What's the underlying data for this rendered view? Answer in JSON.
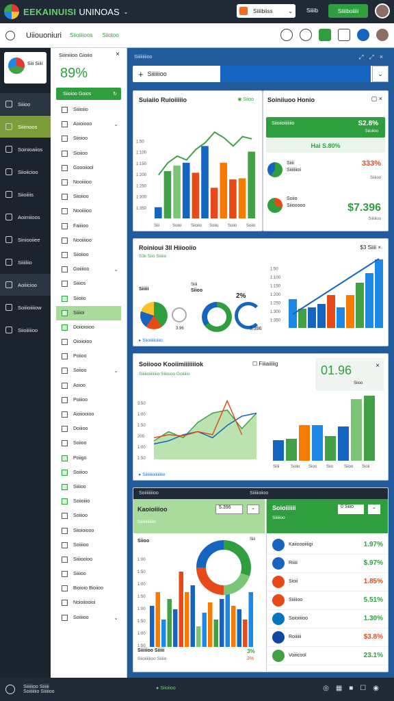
{
  "topbar": {
    "brand": "EEKAINUISI",
    "brand2": "UNINOAS",
    "dropdown": "Siiiibiiss",
    "user": "Siiiib",
    "action": "Siiiiboiiiii"
  },
  "toolbar": {
    "title": "Uiiouoniuri",
    "sub1": "Siioiiiioos",
    "sub2": "Siiotoo"
  },
  "nav": {
    "card_title": "Siii\nSiiii",
    "items": [
      "Siiioo",
      "Siiimoos",
      "Soinioaiios",
      "Siioiicioo",
      "Siioiiiis",
      "Aoimiioos",
      "Siniooiiee",
      "Siiiiliio",
      "Aoiiicioo",
      "Soiiioiiiiow",
      "Siioiiiiioo"
    ]
  },
  "filters": {
    "head": "Siiiniiioo Gioiio",
    "kpi": "89%",
    "green": "Siioioo Goios",
    "rows": [
      "Siiiioiio",
      "Aoioiooo",
      "Siioioo",
      "Sioiioo",
      "Goooiiool",
      "Nooiiiioo",
      "Siioiioo",
      "Nooiiiioo",
      "Faiiiioo",
      "Nooiiiioo",
      "Siioiioo",
      "Goiiiioo",
      "Siiiios",
      "Siioiio",
      "Siiiioi",
      "Doiioioioo",
      "Oioiioioo",
      "Poiioo",
      "Soiioo",
      "Aoioo",
      "Poiiioo",
      "Aioiiooioo",
      "Doiiioo",
      "Soiioo",
      "Poiigo",
      "Soiiioo",
      "Siiiioo",
      "Soiioiiio",
      "Soiiioo",
      "Siioioiooo",
      "Soiiiioo",
      "Siiiiooioo",
      "Siiiioo",
      "Bioioio Bioiioo",
      "Noioiiooioi",
      "Soiiiioo"
    ]
  },
  "main": {
    "header": "Siiiiiiiiioo",
    "search": "Siiiiiioo"
  },
  "p1": {
    "title": "Suiaiio Ruioiiiiio",
    "badge": "Siioo",
    "ticks": [
      "1:350",
      "1:300",
      "1:250",
      "1:200",
      "1:150",
      "1:100",
      "1:50"
    ],
    "xticks": [
      "Siii",
      "Soiio",
      "Siioiio",
      "Soiio",
      "Soiio",
      "Soiio"
    ]
  },
  "p2": {
    "title": "Soiniiuoo Honio",
    "green": "Siioiioiiiiiiio",
    "gval": "S2.8%",
    "gsub": "Siioiioo",
    "pct": "Hai S.80%",
    "r1a": "Siiii",
    "r1b": "Siiiiiiioi",
    "r1v": "333%",
    "r1s": "Siiiioo",
    "r2a": "Soiio",
    "r2b": "Siiooooo",
    "r2v": "$7.396",
    "r2s": "Siiiiiioo"
  },
  "p3": {
    "title": "Roinioui 3ll Hiiooiio",
    "subtitle": "S3ii Siio Siiiiio",
    "badge": "$3 Siiii",
    "l1": "Siiiii",
    "l2": "Siiii",
    "l3": "Siioo",
    "v1": "2%",
    "v2": "3.396",
    "foot": "Siioiiiiioiiio",
    "ticks": [
      "1:350",
      "1:300",
      "1:250",
      "1:200",
      "1:150",
      "1:100",
      "1:50"
    ]
  },
  "p4": {
    "title": "Soiiooo Kooiimiiiiiiiok",
    "sub": "Siiiiioiiiiiiiio Siiioioo Goiiiiio",
    "chk": "Fiiiaiiiiig",
    "kpi": "01.96",
    "kpisub": "Siioo",
    "foot": "Siiiiiiioiiiiiiiio",
    "xt": [
      "Siiii",
      "Soiio",
      "Sioo",
      "Siio",
      "Siioo",
      "Sioii"
    ]
  },
  "p5": {
    "hdr_l": "Soiiiiiiiioo",
    "hdr_r": "Siiiiioiioo",
    "title": "Kaoioiiioo",
    "dd": "5.396",
    "sub": "Siiiiiiiiiiiiio",
    "leg": "Siioo",
    "leg2": "Siii",
    "foot1": "Siiiiioo Siiiii",
    "foot2": "Siioiiiiiioo Siiiio",
    "fv1": "3%",
    "fv2": "3%",
    "rtitle": "Soioiiiiii",
    "rsub": "Siiiiioo",
    "rdd": "0 Siiio",
    "list": [
      {
        "n": "Kaiioooiiiigi",
        "v": "1.97%",
        "c": "#1565c0"
      },
      {
        "n": "Riiiii",
        "v": "$.97%",
        "c": "#1565c0"
      },
      {
        "n": "Sioii",
        "v": "1.85%",
        "c": "#e64a19"
      },
      {
        "n": "Siiiiioo",
        "v": "5.51%",
        "c": "#e64a19"
      },
      {
        "n": "Soioiiiioo",
        "v": "1.30%",
        "c": "#0277bd"
      },
      {
        "n": "Roiiiiii",
        "v": "$3.8%",
        "c": "#0d47a1"
      },
      {
        "n": "Voiiicool",
        "v": "23.1%",
        "c": "#43a047"
      }
    ],
    "listsub": [
      "Siiio",
      "Siiio"
    ]
  },
  "bottom": {
    "l1": "Siiiiiioo Siiiiii",
    "l2": "Soiiiiiiio Siiiiioo",
    "status": "Siioiioo"
  },
  "colors": {
    "green": "#2e9e3f",
    "blue": "#1565c0",
    "orange": "#f57c00",
    "red": "#e64a19"
  },
  "chart_data": [
    {
      "type": "bar",
      "title": "Suiaiio Ruioiiiiio",
      "series": [
        {
          "name": "",
          "values": [
            20,
            85,
            95,
            100,
            82,
            130,
            55,
            100,
            70,
            72,
            120
          ]
        }
      ],
      "line": [
        78,
        100,
        112,
        105,
        124,
        136,
        155,
        145,
        130,
        147,
        143
      ],
      "ylim": [
        0,
        160
      ]
    },
    {
      "type": "bar",
      "title": "Roinioui 3ll Hiiooiio",
      "values": [
        42,
        28,
        30,
        35,
        48,
        30,
        48,
        66,
        80,
        100
      ]
    },
    {
      "type": "area",
      "title": "Soiiooo Kooiimiiiiiiiok",
      "green": [
        30,
        45,
        35,
        60,
        75,
        80,
        50,
        75
      ],
      "blue": [
        25,
        30,
        40,
        45,
        35,
        55,
        70,
        75
      ],
      "red": [
        35,
        40,
        38,
        45,
        40,
        95,
        40
      ]
    },
    {
      "type": "bar",
      "title": "Soiiooo Kooiimiiiiiiiok",
      "values": [
        30,
        32,
        52,
        52,
        36,
        50,
        90,
        95
      ]
    },
    {
      "type": "bar",
      "title": "Kaoioiiioo",
      "values": [
        60,
        80,
        40,
        70,
        55,
        110,
        80,
        90,
        30,
        50,
        65,
        40,
        70,
        100,
        60,
        55,
        40,
        80
      ]
    }
  ]
}
